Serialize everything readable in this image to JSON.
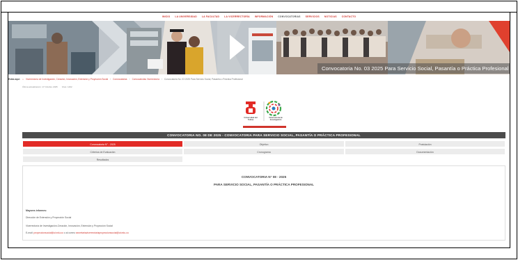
{
  "nav": {
    "items": [
      {
        "label": "Inicio",
        "active": false
      },
      {
        "label": "La Universidad",
        "active": false
      },
      {
        "label": "La Facultad",
        "active": false
      },
      {
        "label": "La Vicerrectoría",
        "active": false
      },
      {
        "label": "Información",
        "active": false
      },
      {
        "label": "Convocatorias",
        "active": true
      },
      {
        "label": "Servicios",
        "active": false
      },
      {
        "label": "Noticias",
        "active": false
      },
      {
        "label": "Contacto",
        "active": false
      }
    ]
  },
  "banner": {
    "title": "Convocatoria No. 03 2025 Para Servicio Social, Pasantía o Práctica Profesional"
  },
  "breadcrumb": {
    "lead": "Estás aquí:",
    "items": [
      "Vicerrectoría de Investigación, Creación, Innovación, Extensión y Proyección Social",
      "Convocatorias",
      "Convocatorias Vicerrectoría"
    ],
    "current": "Convocatoria No. 03 2025 Para Servicio Social, Pasantía o Práctica Profesional"
  },
  "meta": {
    "updated": "Última actualización: 17 Octubre 2025",
    "hits": "Visto: 1462"
  },
  "logo": {
    "left_text": "Universidad del Tolima",
    "right_text": "Vicerrectoría de Investigación"
  },
  "page_title": "CONVOCATORIA NO. 08 DE 2025 - CONVOCATORIA PARA SERVICIO SOCIAL, PASANTÍA O PRÁCTICA PROFESIONAL",
  "tabs": [
    {
      "label": "Convocatoria N° - 2025",
      "active": true
    },
    {
      "label": "Objetivo",
      "active": false
    },
    {
      "label": "Postulación",
      "active": false
    },
    {
      "label": "Criterios de Evaluación",
      "active": false
    },
    {
      "label": "Cronograma",
      "active": false
    },
    {
      "label": "Documentación",
      "active": false
    },
    {
      "label": "Resultados",
      "active": false
    }
  ],
  "content": {
    "heading1": "CONVOCATORIA N° 08 - 2025",
    "heading2": "PARA SERVICIO SOCIAL, PASANTÍA O PRÁCTICA PROFESIONAL",
    "info_title": "Mayores informes:",
    "line1": "Dirección de Extensión y Proyección Social",
    "line2": "Vicerrectoría de Investigación-Creación, Innovación, Extensión y Proyección Social",
    "email_prefix": "E-mail:",
    "email1": "proyeccionsocial@ut.edu.co",
    "email_mid": "o al correo",
    "email2": "secretariavicerrectoriaproyeccionsocial@ut.edu.co"
  }
}
